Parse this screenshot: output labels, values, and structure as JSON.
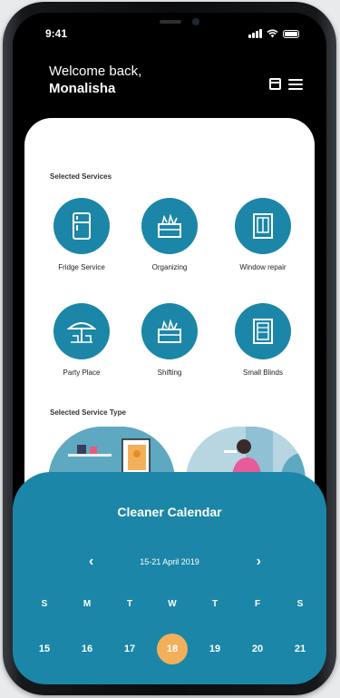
{
  "status_bar": {
    "time": "9:41"
  },
  "header": {
    "welcome": "Welcome back,",
    "user_name": "Monalisha"
  },
  "selected_services": {
    "title": "Selected Services",
    "items": [
      {
        "label": "Fridge Service",
        "icon": "fridge-icon"
      },
      {
        "label": "Organizing",
        "icon": "box-icon"
      },
      {
        "label": "Window repair",
        "icon": "window-icon"
      },
      {
        "label": "Party Place",
        "icon": "party-tent-icon"
      },
      {
        "label": "Shifting",
        "icon": "box-icon"
      },
      {
        "label": "Small Blinds",
        "icon": "blinds-icon"
      }
    ]
  },
  "service_type": {
    "title": "Selected Service Type"
  },
  "calendar": {
    "title": "Cleaner Calendar",
    "range": "15-21 April 2019",
    "days": [
      "S",
      "M",
      "T",
      "W",
      "T",
      "F",
      "S"
    ],
    "dates": [
      "15",
      "16",
      "17",
      "18",
      "19",
      "20",
      "21"
    ],
    "selected_index": 3
  },
  "colors": {
    "primary": "#1b86a7",
    "accent": "#f3b05a",
    "background": "#000000"
  }
}
